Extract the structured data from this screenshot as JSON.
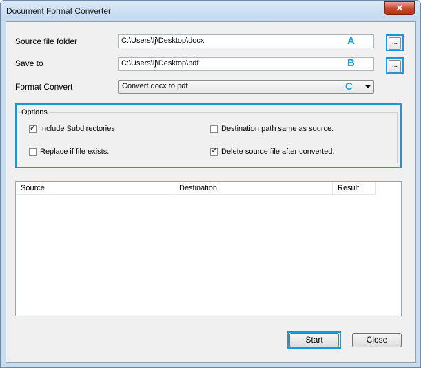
{
  "window": {
    "title": "Document Format Converter",
    "close_glyph": "✕"
  },
  "fields": {
    "source_label": "Source file folder",
    "source_value": "C:\\Users\\lj\\Desktop\\docx",
    "save_label": "Save to",
    "save_value": "C:\\Users\\lj\\Desktop\\pdf",
    "format_label": "Format Convert",
    "format_value": "Convert docx to pdf",
    "browse_label": "..."
  },
  "annotations": {
    "a": "A",
    "b": "B",
    "c": "C"
  },
  "options": {
    "title": "Options",
    "include_subdirs": {
      "label": "Include Subdirectories",
      "checked": true
    },
    "dest_same": {
      "label": "Destination path same as source.",
      "checked": false
    },
    "replace": {
      "label": "Replace if file exists.",
      "checked": false
    },
    "delete_source": {
      "label": "Delete source file after converted.",
      "checked": true
    }
  },
  "list": {
    "columns": [
      "Source",
      "Destination",
      "Result"
    ]
  },
  "buttons": {
    "start": "Start",
    "close": "Close"
  },
  "colors": {
    "highlight": "#1a99d9",
    "annotation_letter": "#1ba3e0"
  }
}
